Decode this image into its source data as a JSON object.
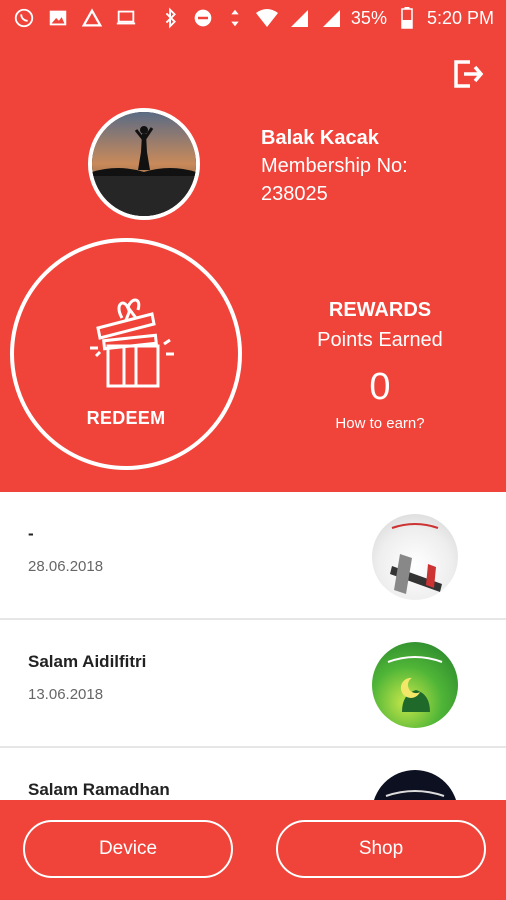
{
  "status_bar": {
    "battery": "35%",
    "time": "5:20 PM",
    "left_icons": [
      "whatsapp-icon",
      "gallery-icon",
      "a-app-icon",
      "laptop-icon"
    ],
    "right_icons": [
      "bluetooth-icon",
      "do-not-disturb-icon",
      "data-arrows-icon",
      "wifi-icon",
      "signal-icon",
      "signal-icon",
      "battery-icon"
    ]
  },
  "profile": {
    "name": "Balak Kacak",
    "membership_label": "Membership No:",
    "membership_no": "238025"
  },
  "redeem": {
    "label": "REDEEM"
  },
  "rewards": {
    "title": "REWARDS",
    "subtitle": "Points Earned",
    "points": "0",
    "how_to_earn": "How to earn?"
  },
  "feed": [
    {
      "title": "-",
      "date": "28.06.2018"
    },
    {
      "title": "Salam Aidilfitri",
      "date": "13.06.2018"
    },
    {
      "title": "Salam Ramadhan",
      "date": ""
    }
  ],
  "bottom_nav": {
    "device_label": "Device",
    "shop_label": "Shop"
  },
  "colors": {
    "primary": "#f0433a",
    "text_dark": "#222222",
    "text_muted": "#666666"
  }
}
